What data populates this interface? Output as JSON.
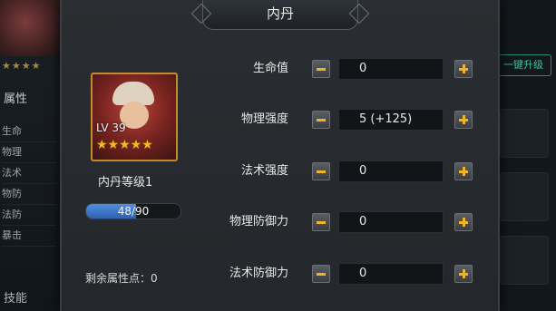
{
  "dialog": {
    "title": "内丹"
  },
  "hero": {
    "level": "LV 39",
    "stars": "★★★★★",
    "neidan_level_label": "内丹等级1",
    "progress_text": "48/90",
    "progress_fraction": 0.533,
    "remaining_points_label": "剩余属性点：0"
  },
  "attributes": [
    {
      "label": "生命值",
      "value": "0"
    },
    {
      "label": "物理强度",
      "value": "5 (+125)"
    },
    {
      "label": "法术强度",
      "value": "0"
    },
    {
      "label": "物理防御力",
      "value": "0"
    },
    {
      "label": "法术防御力",
      "value": "0"
    }
  ],
  "background": {
    "left_title": "属性",
    "left_stars": "★★★★",
    "left_items": [
      "生命",
      "物理",
      "法术",
      "物防",
      "法防",
      "暴击"
    ],
    "left_bottom": "技能",
    "right_button": "一键升级"
  },
  "colors": {
    "accent": "#f0b323",
    "progress": "#3f7ad0",
    "card_border": "#c58a2a"
  }
}
